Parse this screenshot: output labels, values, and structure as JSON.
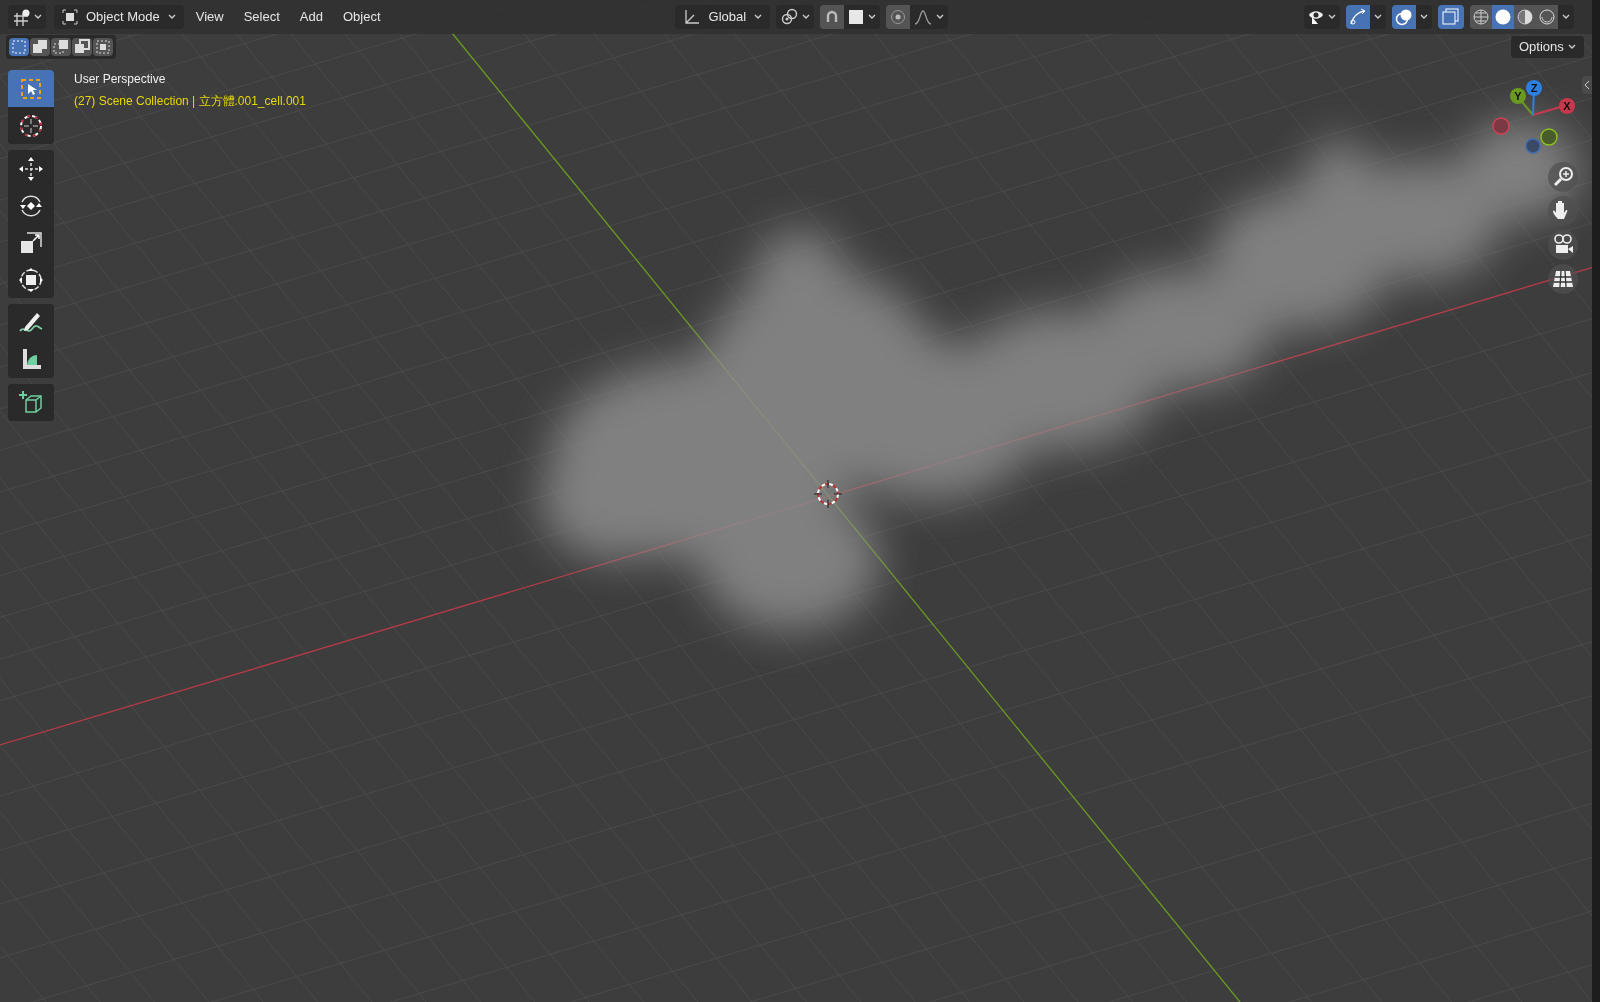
{
  "header": {
    "mode": "Object Mode",
    "menus": [
      {
        "label": "View"
      },
      {
        "label": "Select"
      },
      {
        "label": "Add"
      },
      {
        "label": "Object"
      }
    ],
    "transform_orientation": "Global",
    "snap_on": false,
    "proportional_on": false,
    "gizmos_on": true,
    "overlays_on": true,
    "xray_on": true,
    "shading": [
      {
        "kind": "wireframe",
        "selected": false
      },
      {
        "kind": "solid",
        "selected": true
      },
      {
        "kind": "material",
        "selected": false
      },
      {
        "kind": "rendered",
        "selected": false
      }
    ]
  },
  "select_modes": [
    {
      "kind": "new",
      "selected": true
    },
    {
      "kind": "extend",
      "selected": false
    },
    {
      "kind": "subtract",
      "selected": false
    },
    {
      "kind": "invert",
      "selected": false
    },
    {
      "kind": "intersect",
      "selected": false
    }
  ],
  "options": "Options",
  "tool_groups": [
    {
      "tools": [
        {
          "kind": "select",
          "selected": true
        },
        {
          "kind": "cursor",
          "selected": false
        }
      ]
    },
    {
      "tools": [
        {
          "kind": "move",
          "selected": false
        },
        {
          "kind": "rotate",
          "selected": false
        },
        {
          "kind": "scale",
          "selected": false
        },
        {
          "kind": "transform",
          "selected": false
        }
      ]
    },
    {
      "tools": [
        {
          "kind": "annotate",
          "selected": false
        },
        {
          "kind": "measure",
          "selected": false
        }
      ]
    },
    {
      "tools": [
        {
          "kind": "add-cube",
          "selected": false
        }
      ]
    }
  ],
  "overlay_text": {
    "view": "User Perspective",
    "object": "(27) Scene Collection | 立方體.001_cell.001"
  },
  "nav_gizmo": {
    "x": "X",
    "y": "Y",
    "z": "Z"
  }
}
